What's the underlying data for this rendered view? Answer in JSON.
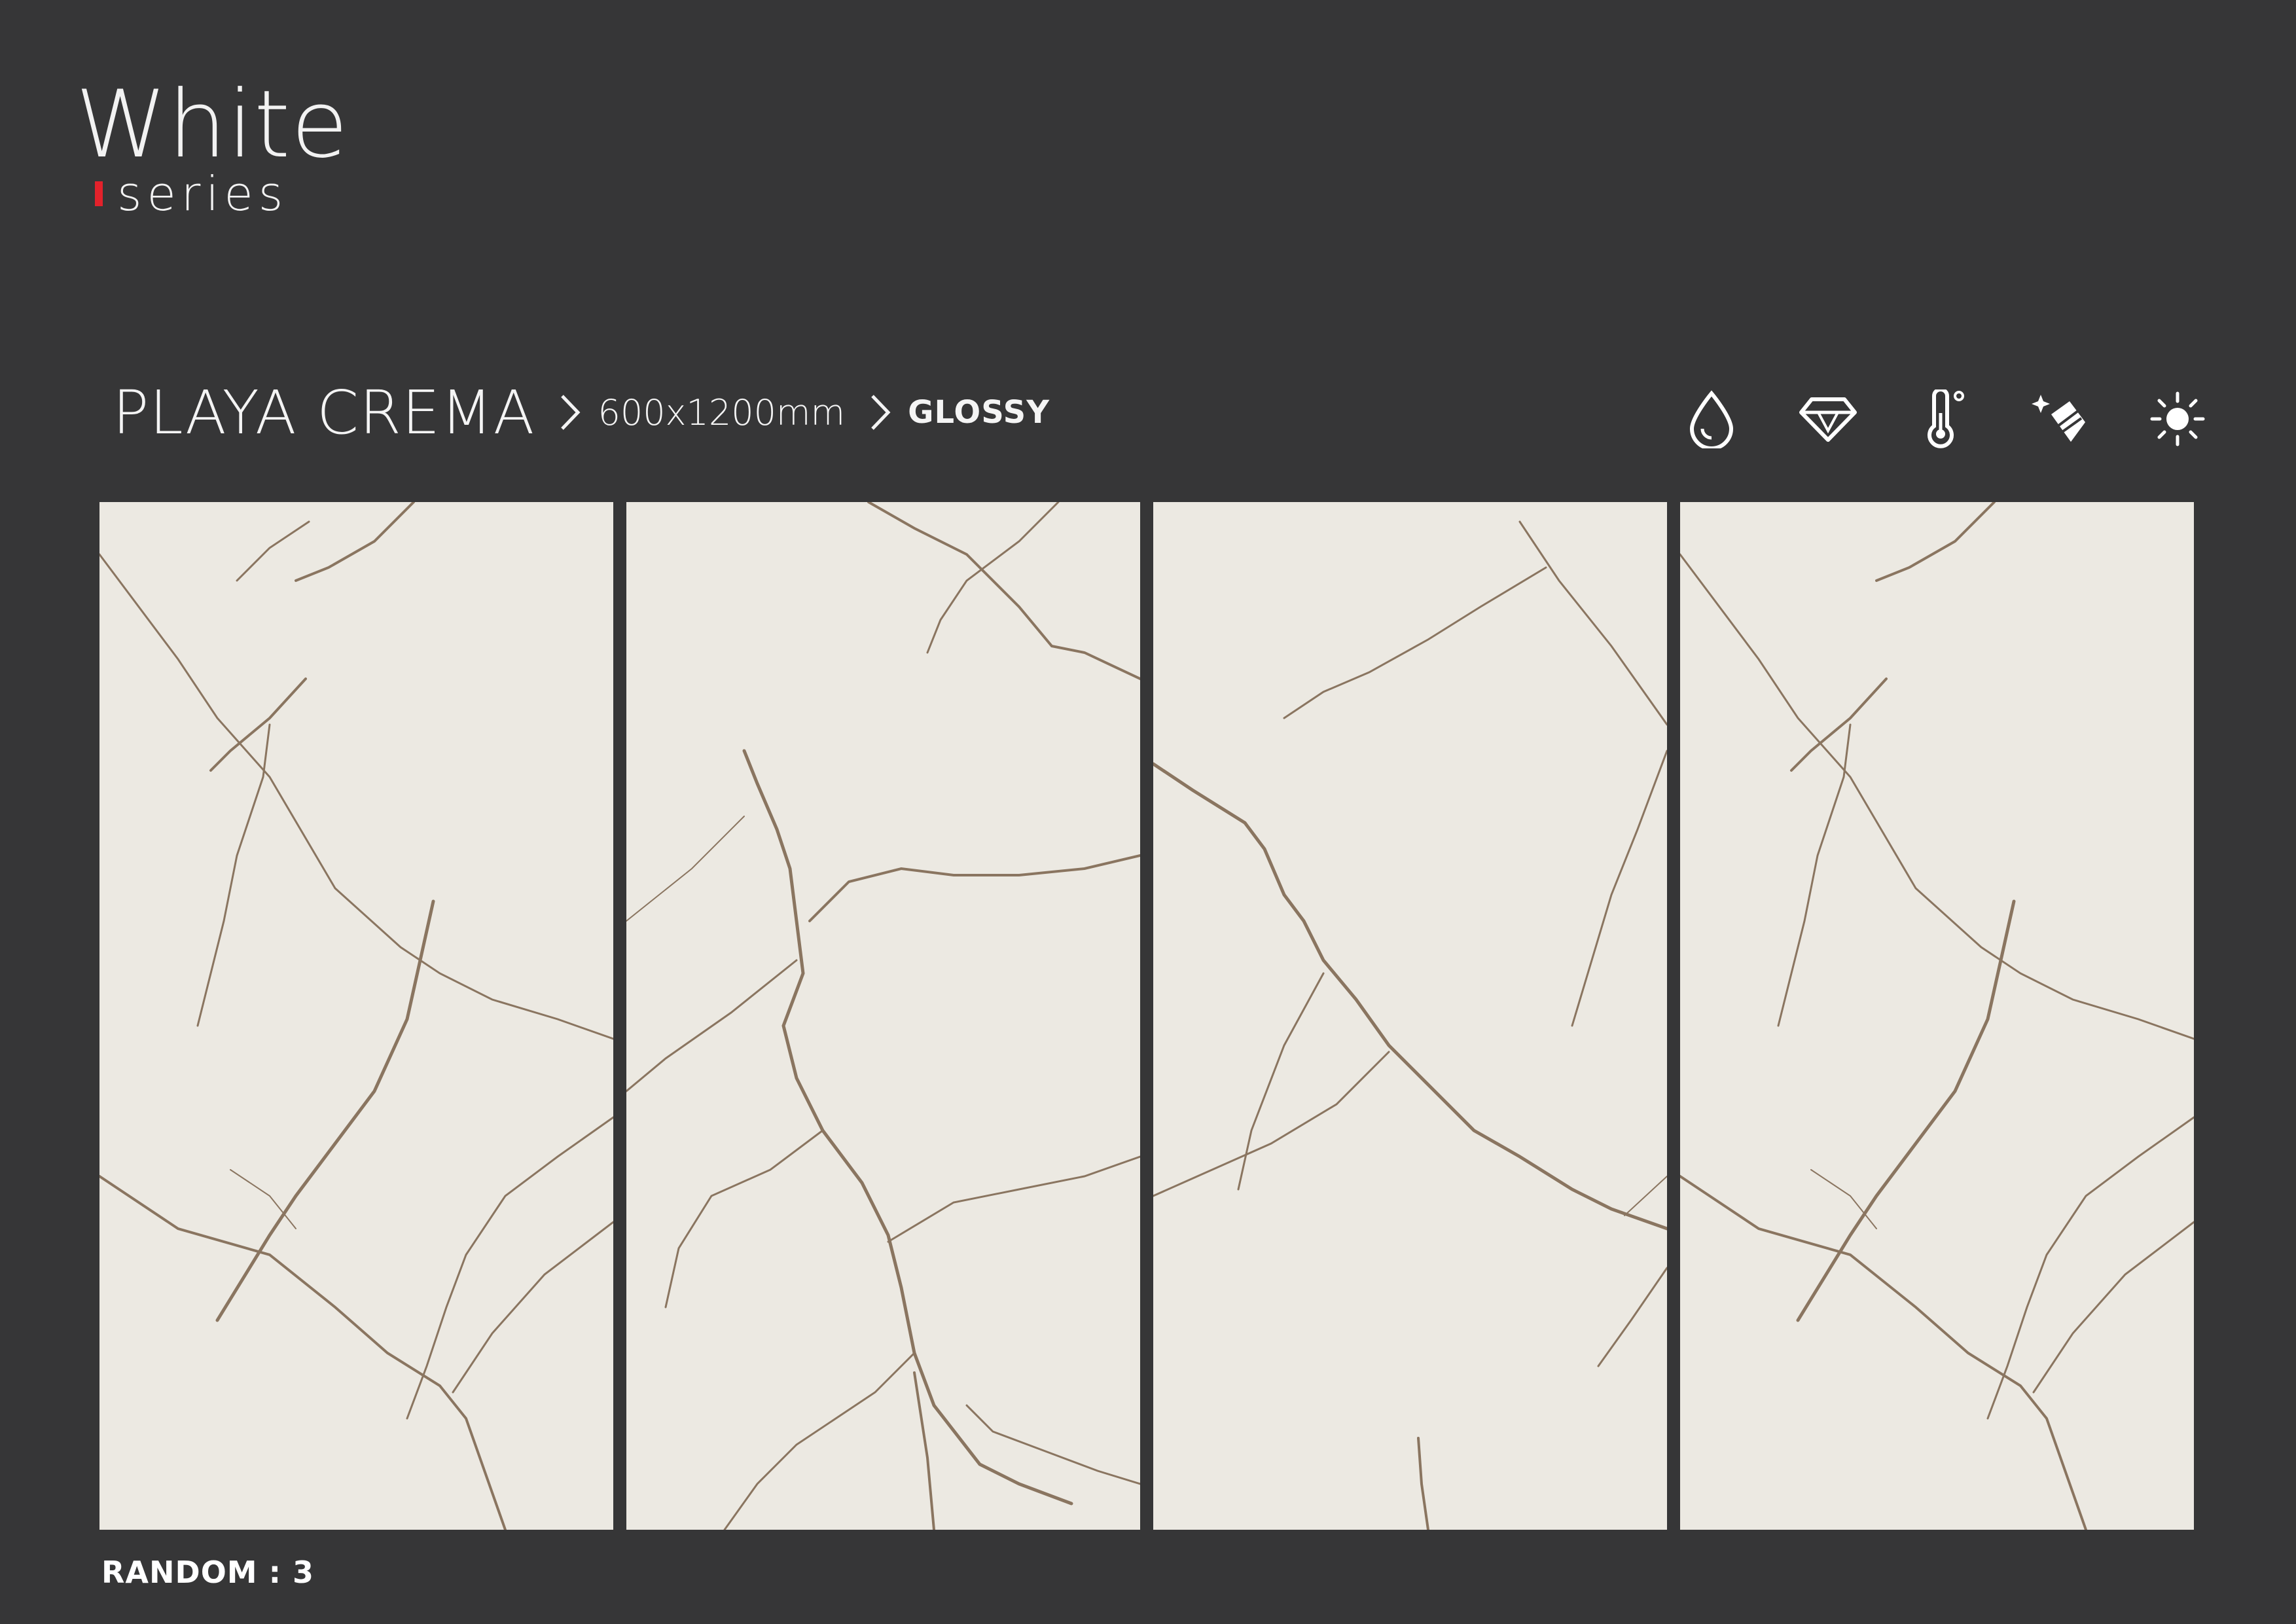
{
  "brand": {
    "title": "White",
    "subtitle": "series",
    "accent_color": "#e3222b"
  },
  "product": {
    "name": "PLAYA CREMA",
    "size": "600x1200mm",
    "finish": "GLOSSY"
  },
  "feature_icons": [
    "water-drop-icon",
    "diamond-icon",
    "thermometer-icon",
    "cleaning-hand-icon",
    "sun-icon"
  ],
  "tiles": [
    {
      "name": "tile-1",
      "pattern": "marble-veins"
    },
    {
      "name": "tile-2",
      "pattern": "marble-veins"
    },
    {
      "name": "tile-3",
      "pattern": "marble-veins"
    },
    {
      "name": "tile-4",
      "pattern": "marble-veins"
    }
  ],
  "footer": {
    "random": "RANDOM : 3"
  },
  "colors": {
    "background": "#363637",
    "tile": "#ece9e2",
    "vein": "#8a7560"
  }
}
